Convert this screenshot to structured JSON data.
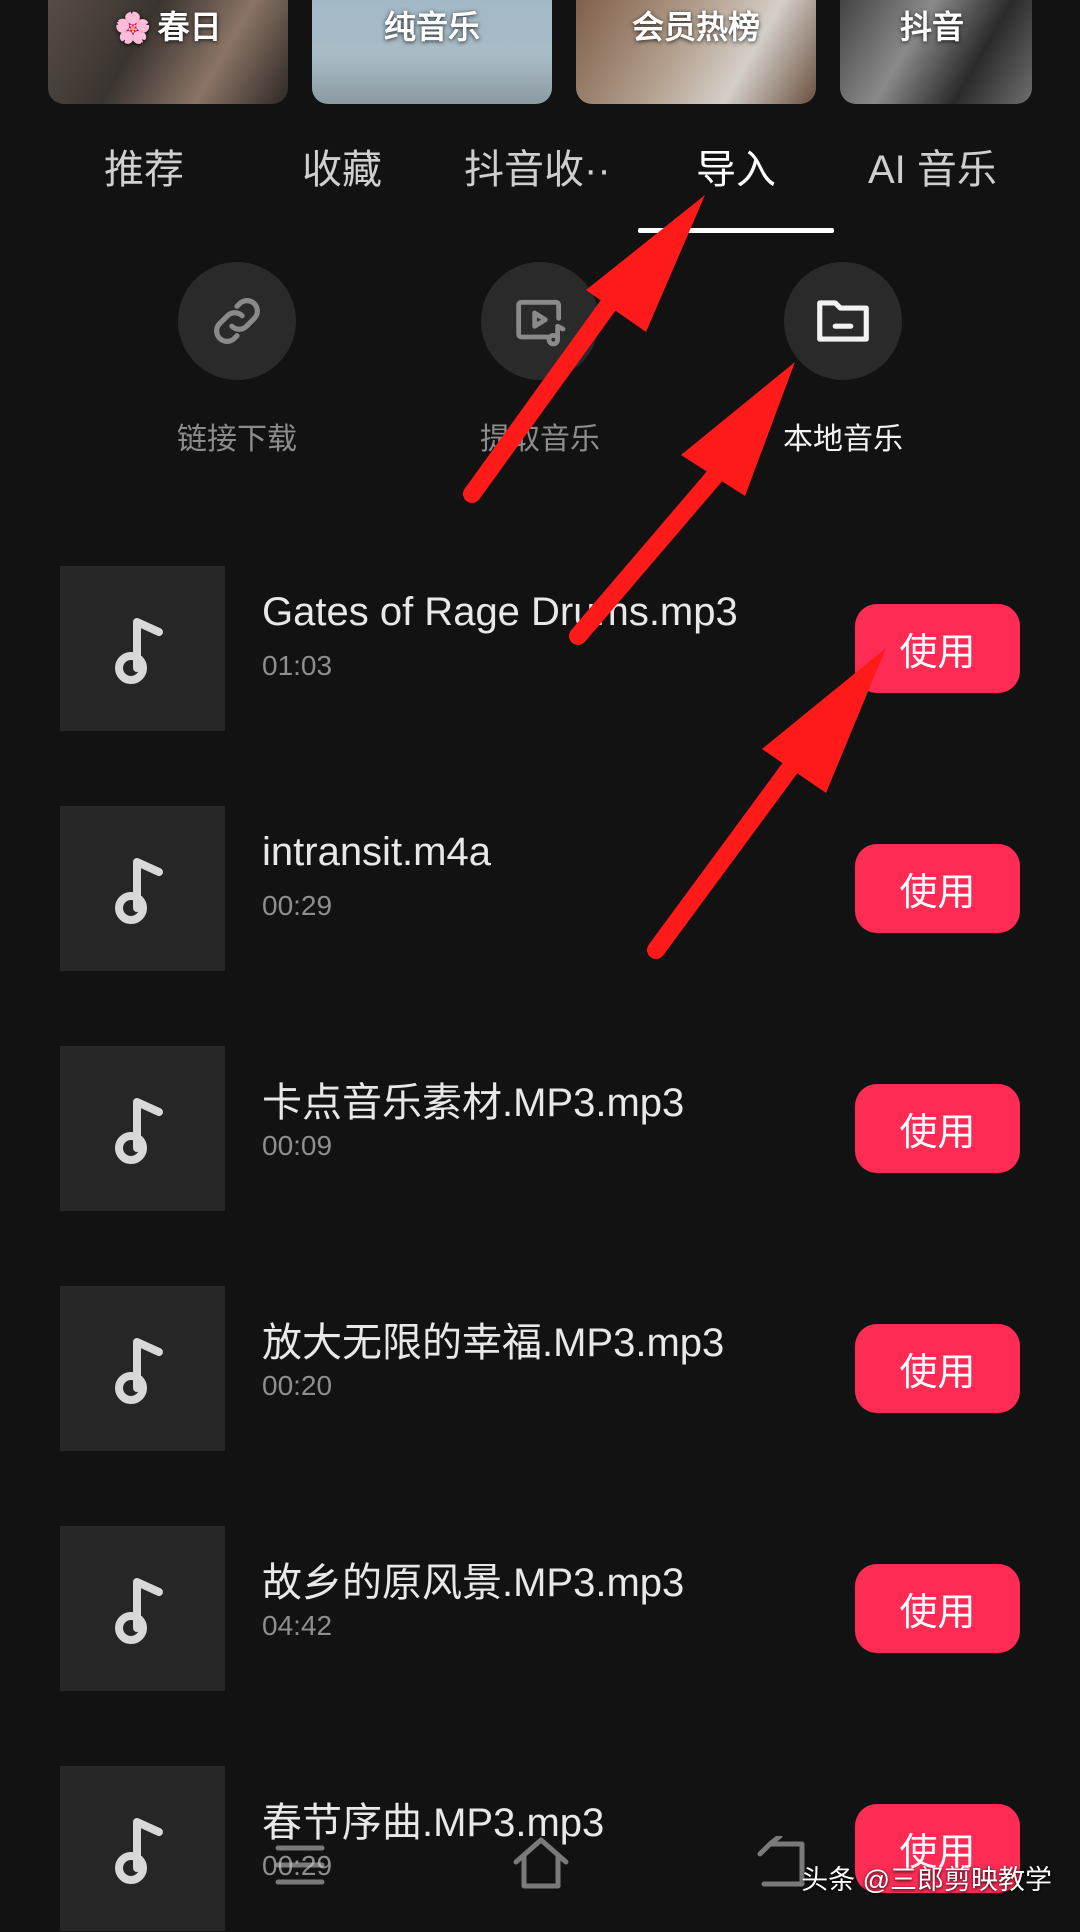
{
  "top_cards": [
    {
      "label": "春日",
      "icon": "cherry-blossom-icon"
    },
    {
      "label": "纯音乐"
    },
    {
      "label": "会员热榜"
    },
    {
      "label": "抖音"
    }
  ],
  "tabs": [
    {
      "label": "推荐",
      "active": false
    },
    {
      "label": "收藏",
      "active": false
    },
    {
      "label": "抖音收··",
      "active": false
    },
    {
      "label": "导入",
      "active": true
    },
    {
      "label": "AI 音乐",
      "active": false
    }
  ],
  "import_actions": [
    {
      "label": "链接下载",
      "icon": "link-icon"
    },
    {
      "label": "提取音乐",
      "icon": "video-music-icon"
    },
    {
      "label": "本地音乐",
      "icon": "folder-icon",
      "active": true
    }
  ],
  "music_list": [
    {
      "name": "Gates of Rage Drums.mp3",
      "duration": "01:03",
      "button": "使用"
    },
    {
      "name": "intransit.m4a",
      "duration": "00:29",
      "button": "使用"
    },
    {
      "name": "卡点音乐素材.MP3.mp3",
      "duration": "00:09",
      "button": "使用"
    },
    {
      "name": "放大无限的幸福.MP3.mp3",
      "duration": "00:20",
      "button": "使用"
    },
    {
      "name": "故乡的原风景.MP3.mp3",
      "duration": "04:42",
      "button": "使用"
    },
    {
      "name": "春节序曲.MP3.mp3",
      "duration": "00:29",
      "button": "使用"
    }
  ],
  "watermark": "头条 @三郎剪映教学",
  "colors": {
    "accent": "#fe2c55",
    "annotation_arrow": "#ff1a1a",
    "background": "#121212"
  }
}
